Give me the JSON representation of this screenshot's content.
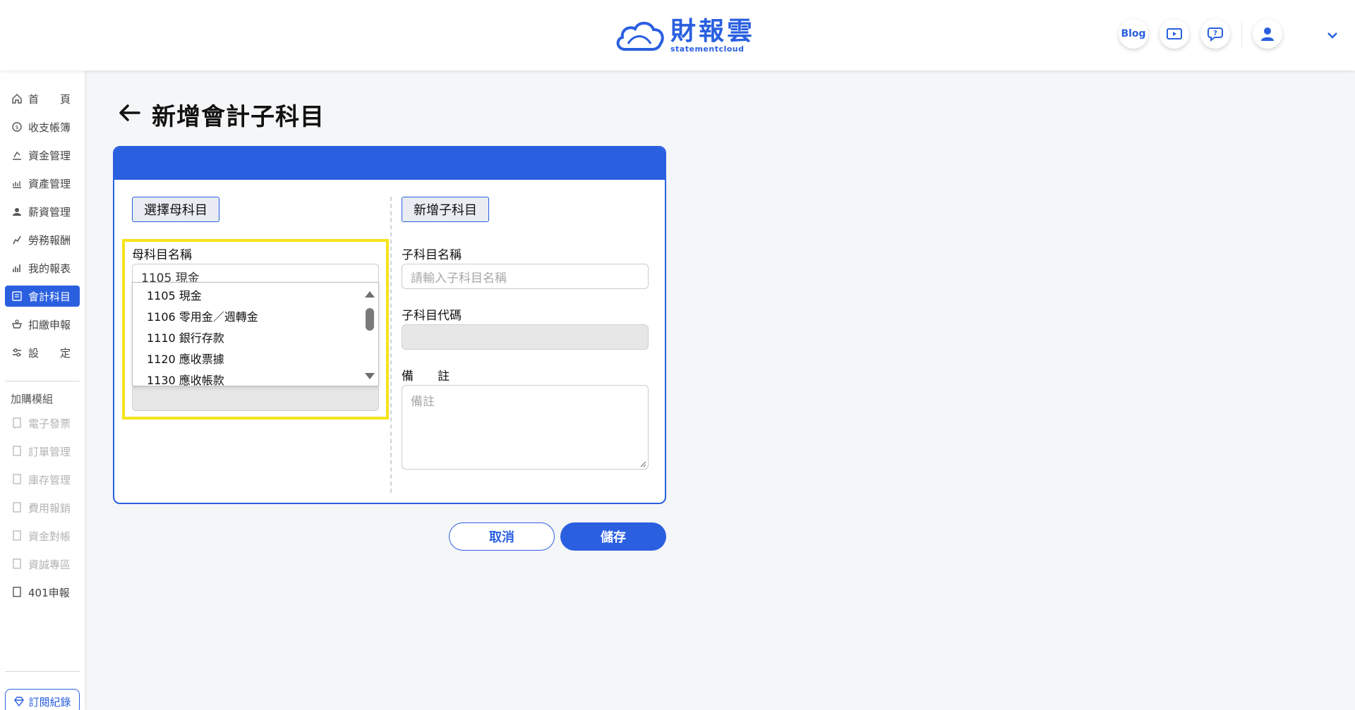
{
  "header": {
    "logo_name": "財報雲",
    "logo_sub": "statementcloud",
    "blog_label": "Blog"
  },
  "sidebar": {
    "items": [
      {
        "label": "首　　頁",
        "icon": "home-icon"
      },
      {
        "label": "收支帳簿",
        "icon": "coin-icon"
      },
      {
        "label": "資金管理",
        "icon": "cash-icon"
      },
      {
        "label": "資產管理",
        "icon": "bank-icon"
      },
      {
        "label": "薪資管理",
        "icon": "payroll-icon"
      },
      {
        "label": "勞務報酬",
        "icon": "labor-icon"
      },
      {
        "label": "我的報表",
        "icon": "report-icon"
      },
      {
        "label": "會計科目",
        "icon": "ledger-icon"
      },
      {
        "label": "扣繳申報",
        "icon": "tax-icon"
      },
      {
        "label": "設　　定",
        "icon": "settings-icon"
      }
    ],
    "addon_heading": "加購模組",
    "addons": [
      {
        "label": "電子發票"
      },
      {
        "label": "訂單管理"
      },
      {
        "label": "庫存管理"
      },
      {
        "label": "費用報銷"
      },
      {
        "label": "資金對帳"
      },
      {
        "label": "資誠專區"
      },
      {
        "label": "401申報"
      }
    ],
    "subscription_label": "訂閱紀錄"
  },
  "page": {
    "title": "新增會計子科目"
  },
  "form": {
    "parent_section_label": "選擇母科目",
    "child_section_label": "新增子科目",
    "parent_name_label": "母科目名稱",
    "parent_name_value": "1105 現金",
    "dropdown_options": [
      "1105 現金",
      "1106 零用金／週轉金",
      "1110 銀行存款",
      "1120 應收票據",
      "1130 應收帳款"
    ],
    "child_name_label": "子科目名稱",
    "child_name_placeholder": "請輸入子科目名稱",
    "child_code_label": "子科目代碼",
    "note_label": "備　　註",
    "note_placeholder": "備註"
  },
  "actions": {
    "cancel_label": "取消",
    "save_label": "儲存"
  },
  "colors": {
    "accent": "#2a5fe0",
    "highlight": "#f6e31a"
  }
}
